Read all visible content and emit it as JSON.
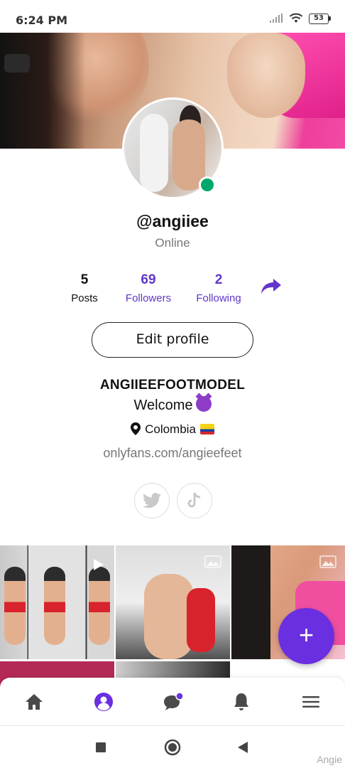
{
  "status_bar": {
    "time": "6:24 PM",
    "battery": "53"
  },
  "profile": {
    "username": "@angiiee",
    "status": "Online",
    "stats": [
      {
        "value": "5",
        "label": "Posts"
      },
      {
        "value": "69",
        "label": "Followers"
      },
      {
        "value": "2",
        "label": "Following"
      }
    ],
    "edit_label": "Edit profile",
    "display_name": "ANGIIEEFOOTMODEL",
    "bio": "Welcome",
    "location": "Colombia",
    "website": "onlyfans.com/angieefeet"
  },
  "social_icons": [
    "twitter-icon",
    "tiktok-icon"
  ],
  "grid": {
    "tile_count": 5,
    "video_tile_index": 0
  },
  "fab": {
    "label": "+"
  },
  "bottom_nav": [
    "home-icon",
    "profile-icon",
    "messages-icon",
    "notifications-icon",
    "menu-icon"
  ],
  "watermark": "Angie",
  "colors": {
    "accent": "#6236c9",
    "fab": "#6a2fe0",
    "online": "#00a86b"
  }
}
